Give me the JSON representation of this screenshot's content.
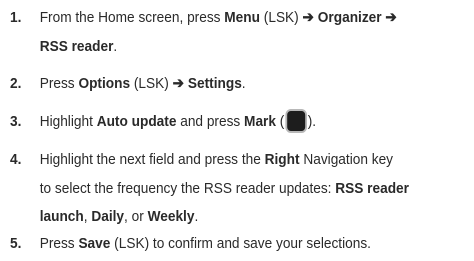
{
  "steps": [
    {
      "number": "1.",
      "line1": {
        "t1": "From the Home screen, press ",
        "b1": "Menu",
        "t2": " (LSK) ",
        "arrow1": "➔",
        "b2": " Organizer",
        "arrow2": " ➔"
      },
      "line2": {
        "b1": "RSS reader",
        "t1": "."
      }
    },
    {
      "number": "2.",
      "line1": {
        "t1": "Press ",
        "b1": "Options",
        "t2": " (LSK) ",
        "arrow1": "➔",
        "b2": " Settings",
        "t3": "."
      }
    },
    {
      "number": "3.",
      "line1": {
        "t1": "Highlight ",
        "b1": "Auto update",
        "t2": " and press ",
        "b2": "Mark",
        "t3": " (",
        "icon": "center-select-key-icon",
        "t4": ")."
      }
    },
    {
      "number": "4.",
      "line1": {
        "t1": "Highlight the next field and press the ",
        "b1": "Right",
        "t2": " Navigation key"
      },
      "line2": {
        "t1": "to select the frequency the RSS reader updates: ",
        "b1": "RSS reader"
      },
      "line3": {
        "b1": "launch",
        "t1": ", ",
        "b2": "Daily",
        "t2": ", or ",
        "b3": "Weekly",
        "t3": "."
      }
    },
    {
      "number": "5.",
      "line1": {
        "t1": "Press ",
        "b1": "Save",
        "t2": " (LSK) to confirm and save your selections."
      }
    }
  ]
}
